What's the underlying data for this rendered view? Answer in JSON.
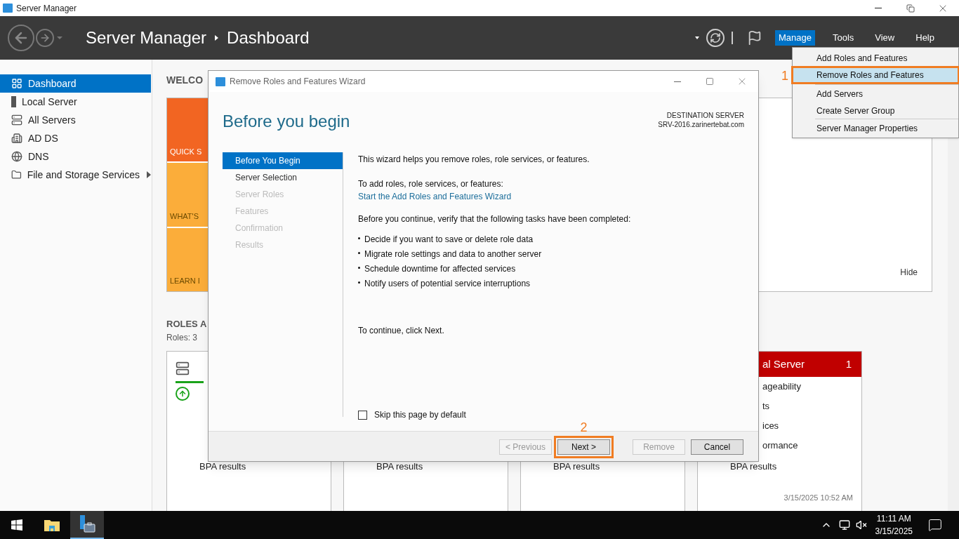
{
  "window": {
    "title": "Server Manager"
  },
  "header": {
    "breadcrumb": [
      "Server Manager",
      "Dashboard"
    ],
    "menus": [
      {
        "label": "Manage",
        "selected": true
      },
      {
        "label": "Tools",
        "selected": false
      },
      {
        "label": "View",
        "selected": false
      },
      {
        "label": "Help",
        "selected": false
      }
    ]
  },
  "sidebar": {
    "items": [
      {
        "label": "Dashboard",
        "kind": "dashboard",
        "selected": true,
        "expandable": false
      },
      {
        "label": "Local Server",
        "kind": "server",
        "selected": false,
        "expandable": false
      },
      {
        "label": "All Servers",
        "kind": "servers",
        "selected": false,
        "expandable": false
      },
      {
        "label": "AD DS",
        "kind": "directory",
        "selected": false,
        "expandable": false
      },
      {
        "label": "DNS",
        "kind": "dns",
        "selected": false,
        "expandable": false
      },
      {
        "label": "File and Storage Services",
        "kind": "storage",
        "selected": false,
        "expandable": true
      }
    ]
  },
  "welcome": {
    "heading": "WELCO",
    "tiles": [
      {
        "label": "QUICK S",
        "color": "#f26522"
      },
      {
        "label": "WHAT'S",
        "color": "#fbad3a"
      },
      {
        "label": "LEARN I",
        "color": "#fbad3a"
      }
    ],
    "hide": "Hide"
  },
  "roles": {
    "heading": "ROLES A",
    "count": "Roles: 3",
    "cards": [
      {
        "kind": "role",
        "bpa": "BPA results"
      },
      {
        "kind": "covered",
        "bpa": "BPA results"
      },
      {
        "kind": "covered",
        "bpa": "BPA results"
      },
      {
        "kind": "server",
        "title": "al Server",
        "count": "1",
        "items": [
          "ageability",
          "ts",
          "ices",
          "ormance"
        ],
        "bpa": "BPA results",
        "timestamp": "3/15/2025 10:52 AM"
      }
    ]
  },
  "menu": {
    "callout": "1",
    "groups": [
      [
        {
          "label": "Add Roles and Features",
          "selected": false
        },
        {
          "label": "Remove Roles and Features",
          "selected": true
        }
      ],
      [
        {
          "label": "Add Servers",
          "selected": false
        },
        {
          "label": "Create Server Group",
          "selected": false
        }
      ],
      [
        {
          "label": "Server Manager Properties",
          "selected": false
        }
      ]
    ]
  },
  "wizard": {
    "title": "Remove Roles and Features Wizard",
    "heading": "Before you begin",
    "destination_label": "DESTINATION SERVER",
    "destination_server": "SRV-2016.zarinertebat.com",
    "steps": [
      {
        "label": "Before You Begin",
        "selected": true,
        "disabled": false
      },
      {
        "label": "Server Selection",
        "selected": false,
        "disabled": false
      },
      {
        "label": "Server Roles",
        "selected": false,
        "disabled": true
      },
      {
        "label": "Features",
        "selected": false,
        "disabled": true
      },
      {
        "label": "Confirmation",
        "selected": false,
        "disabled": true
      },
      {
        "label": "Results",
        "selected": false,
        "disabled": true
      }
    ],
    "intro": "This wizard helps you remove roles, role services, or features.",
    "add_label": "To add roles, role services, or features:",
    "add_link": "Start the Add Roles and Features Wizard",
    "verify": "Before you continue, verify that the following tasks have been completed:",
    "tasks": [
      "Decide if you want to save or delete role data",
      "Migrate role settings and data to another server",
      "Schedule downtime for affected services",
      "Notify users of potential service interruptions"
    ],
    "continue": "To continue, click Next.",
    "skip": {
      "label": "Skip this page by default",
      "checked": false
    },
    "buttons": [
      {
        "label": "< Previous",
        "disabled": true
      },
      {
        "label": "Next >",
        "disabled": false,
        "callout": "2"
      },
      {
        "label": "Remove",
        "disabled": true
      },
      {
        "label": "Cancel",
        "disabled": false
      }
    ]
  },
  "taskbar": {
    "apps": [
      {
        "kind": "start",
        "selected": false
      },
      {
        "kind": "explorer",
        "selected": false
      },
      {
        "kind": "server_manager",
        "selected": true
      }
    ],
    "time": "11:11 AM",
    "date": "3/15/2025"
  }
}
